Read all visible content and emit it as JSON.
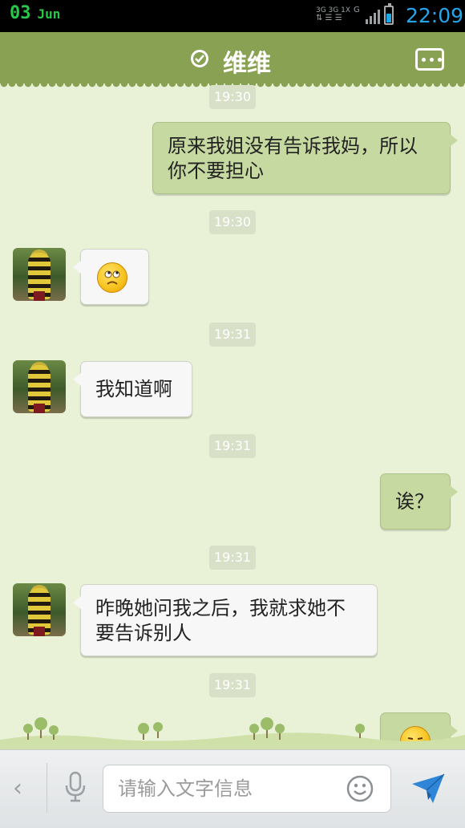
{
  "status_bar": {
    "day": "03",
    "month": "Jun",
    "network_top": "3G 3G 1X",
    "network_bottom": "G",
    "time": "22:09"
  },
  "header": {
    "contact_name": "维维"
  },
  "messages": [
    {
      "type": "timestamp",
      "text": "19:30"
    },
    {
      "type": "sent",
      "text": "原来我姐没有告诉我妈，所以你不要担心"
    },
    {
      "type": "timestamp",
      "text": "19:30"
    },
    {
      "type": "received",
      "emoji": "rolling-eyes-emoji"
    },
    {
      "type": "timestamp",
      "text": "19:31"
    },
    {
      "type": "received",
      "text": "我知道啊"
    },
    {
      "type": "timestamp",
      "text": "19:31"
    },
    {
      "type": "sent",
      "text": "诶？"
    },
    {
      "type": "timestamp",
      "text": "19:31"
    },
    {
      "type": "received",
      "text": "昨晚她问我之后，我就求她不要告诉别人"
    },
    {
      "type": "timestamp",
      "text": "19:31"
    },
    {
      "type": "sent",
      "emoji": "sweat-emoji"
    }
  ],
  "input_bar": {
    "placeholder": "请输入文字信息"
  },
  "colors": {
    "header_bg": "#88a153",
    "chat_bg": "#e9f2d7",
    "sent_bubble": "#c6d9a0",
    "received_bubble": "#f7f7f7",
    "time_color": "#24a6e8",
    "date_color": "#28c94a"
  },
  "icons": {
    "verified": "check-circle-icon",
    "more": "more-dots-icon",
    "back": "chevron-left-icon",
    "voice": "microphone-icon",
    "emoji": "smiley-icon",
    "send": "send-icon"
  }
}
